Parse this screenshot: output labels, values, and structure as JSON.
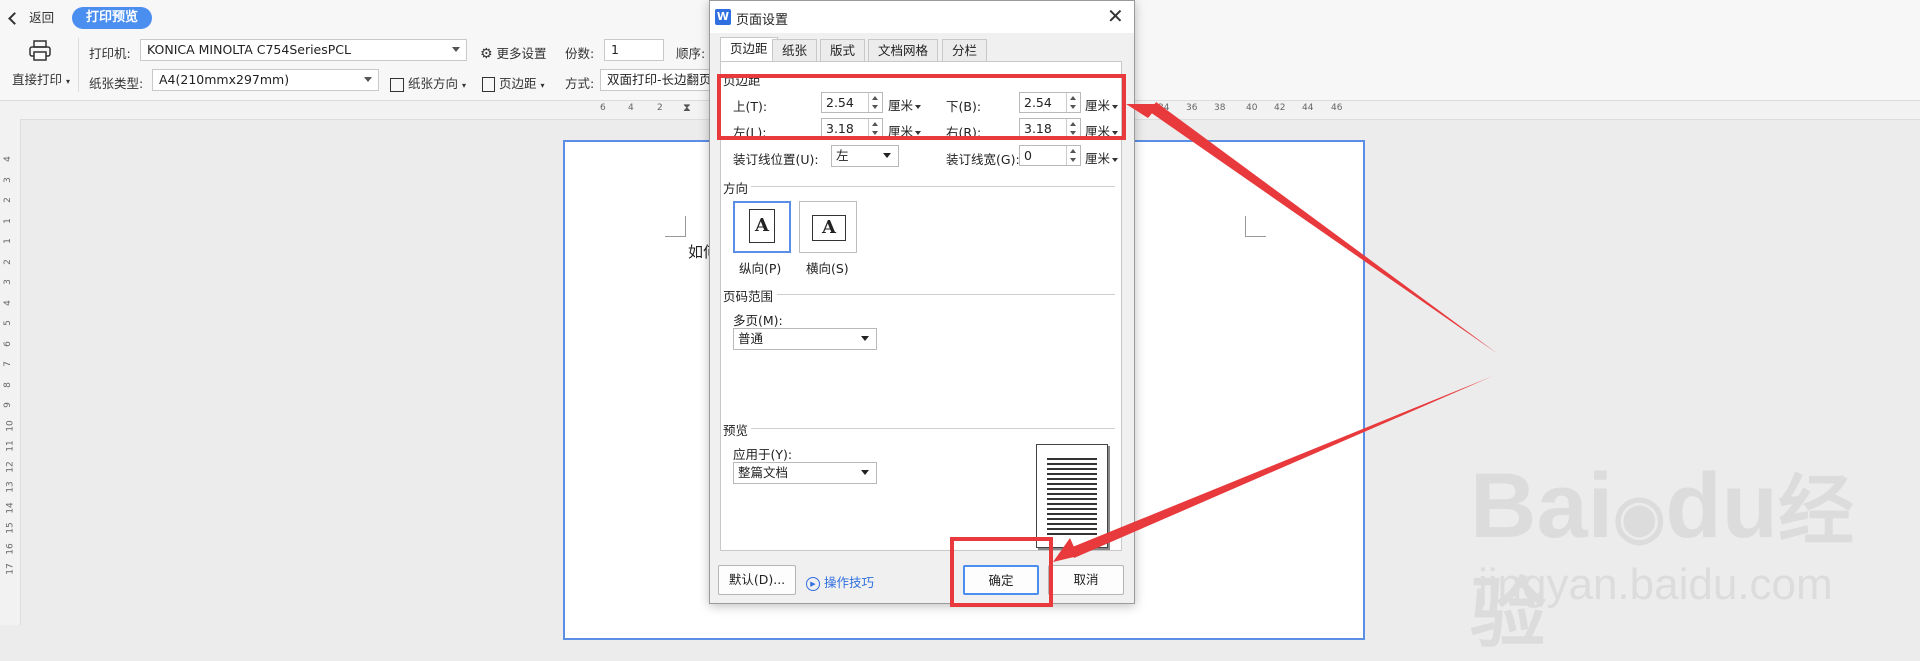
{
  "toolbar": {
    "back_label": "返回",
    "preview_label": "打印预览",
    "direct_print_label": "直接打印",
    "printer_label": "打印机:",
    "printer_value": "KONICA MINOLTA C754SeriesPCL",
    "more_settings_label": "更多设置",
    "copies_label": "份数:",
    "copies_value": "1",
    "order_label": "顺序:",
    "paper_type_label": "纸张类型:",
    "paper_type_value": "A4(210mmx297mm)",
    "paper_orientation_label": "纸张方向",
    "margins_label": "页边距",
    "method_label": "方式:",
    "method_value": "双面打印-长边翻页"
  },
  "ruler": {
    "top_ticks": [
      "6",
      "4",
      "2",
      "34",
      "36",
      "38",
      "40",
      "42",
      "44",
      "46"
    ],
    "left_ticks": [
      "4",
      "3",
      "2",
      "1",
      "1",
      "2",
      "3",
      "4",
      "5",
      "6",
      "7",
      "8",
      "9",
      "10",
      "11",
      "12",
      "13",
      "14",
      "15",
      "16",
      "17"
    ]
  },
  "document": {
    "visible_text": "如何"
  },
  "dialog": {
    "title": "页面设置",
    "tabs": [
      {
        "label": "页边距",
        "active": true
      },
      {
        "label": "纸张",
        "active": false
      },
      {
        "label": "版式",
        "active": false
      },
      {
        "label": "文档网格",
        "active": false
      },
      {
        "label": "分栏",
        "active": false
      }
    ],
    "margins_section": "页边距",
    "top_label": "上(T):",
    "top_value": "2.54",
    "bottom_label": "下(B):",
    "bottom_value": "2.54",
    "left_label": "左(L):",
    "left_value": "3.18",
    "right_label": "右(R):",
    "right_value": "3.18",
    "unit": "厘米",
    "gutter_pos_label": "装订线位置(U):",
    "gutter_pos_value": "左",
    "gutter_width_label": "装订线宽(G):",
    "gutter_width_value": "0",
    "orientation_section": "方向",
    "portrait_label": "纵向(P)",
    "landscape_label": "横向(S)",
    "page_range_section": "页码范围",
    "multi_page_label": "多页(M):",
    "multi_page_value": "普通",
    "preview_section": "预览",
    "apply_to_label": "应用于(Y):",
    "apply_to_value": "整篇文档",
    "default_button": "默认(D)...",
    "tips_label": "操作技巧",
    "ok_button": "确定",
    "cancel_button": "取消"
  },
  "watermark": {
    "brand": "Bai",
    "brand2": "du",
    "cn": "经验",
    "url": "jingyan.baidu.com"
  },
  "colors": {
    "annotation_red": "#e8393c",
    "accent_blue": "#4a8ef0"
  }
}
